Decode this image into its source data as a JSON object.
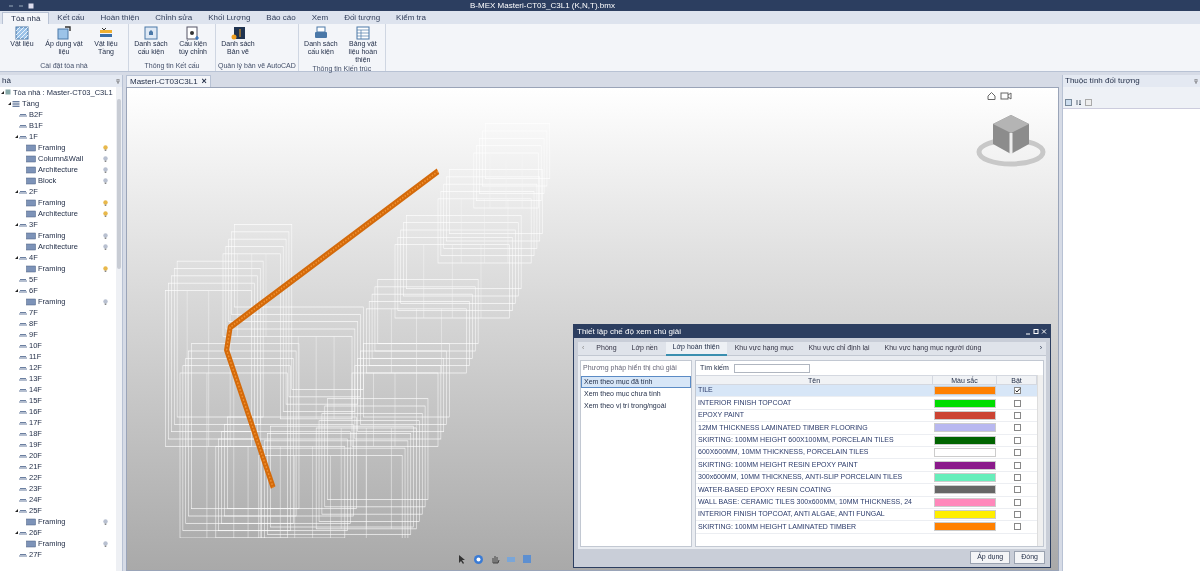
{
  "window": {
    "title": "B-MEX Masteri-CT03_C3L1 (K,N,T).bmx"
  },
  "ribbon": {
    "tabs": [
      {
        "label": "Tòa nhà",
        "selected": true
      },
      {
        "label": "Kết cấu",
        "selected": false
      },
      {
        "label": "Hoàn thiện",
        "selected": false
      },
      {
        "label": "Chỉnh sửa",
        "selected": false
      },
      {
        "label": "Khối Lượng",
        "selected": false
      },
      {
        "label": "Báo cáo",
        "selected": false
      },
      {
        "label": "Xem",
        "selected": false
      },
      {
        "label": "Đối tượng",
        "selected": false
      },
      {
        "label": "Kiểm tra",
        "selected": false
      }
    ],
    "groups": [
      {
        "label": "Cài đặt tòa nhà",
        "buttons": [
          {
            "label": "Vật liệu",
            "kind": "material"
          },
          {
            "label": "Áp dụng vật liệu",
            "kind": "apply"
          },
          {
            "label": "Vật liệu Tầng",
            "kind": "floor"
          }
        ]
      },
      {
        "label": "Thông tin Kết cấu",
        "buttons": [
          {
            "label": "Danh sách cấu kiện",
            "kind": "list"
          },
          {
            "label": "Cấu kiện tùy chỉnh",
            "kind": "custom"
          }
        ]
      },
      {
        "label": "Quản lý bản vẽ AutoCAD",
        "buttons": [
          {
            "label": "Danh sách Bản vẽ",
            "kind": "drawing"
          }
        ]
      },
      {
        "label": "Thông tin Kiến trúc",
        "buttons": [
          {
            "label": "Danh sách cấu kiện",
            "kind": "printer"
          },
          {
            "label": "Bảng vật liệu hoàn thiện",
            "kind": "table"
          }
        ]
      }
    ]
  },
  "left_panel": {
    "title": "hà",
    "tree": {
      "label": "Tòa nhà : Master-CT03_C3L1",
      "kind": "building",
      "children": [
        {
          "label": "Tầng",
          "kind": "group",
          "children": [
            {
              "label": "B2F",
              "kind": "floor"
            },
            {
              "label": "B1F",
              "kind": "floor"
            },
            {
              "label": "1F",
              "kind": "floor",
              "children": [
                {
                  "label": "Framing",
                  "kind": "layer",
                  "lit": true
                },
                {
                  "label": "Column&Wall",
                  "kind": "layer",
                  "lit": false
                },
                {
                  "label": "Architecture",
                  "kind": "layer",
                  "lit": false
                },
                {
                  "label": "Block",
                  "kind": "layer",
                  "lit": false
                }
              ]
            },
            {
              "label": "2F",
              "kind": "floor",
              "children": [
                {
                  "label": "Framing",
                  "kind": "layer",
                  "lit": true
                },
                {
                  "label": "Architecture",
                  "kind": "layer",
                  "lit": true
                }
              ]
            },
            {
              "label": "3F",
              "kind": "floor",
              "children": [
                {
                  "label": "Framing",
                  "kind": "layer",
                  "lit": false
                },
                {
                  "label": "Architecture",
                  "kind": "layer",
                  "lit": false
                }
              ]
            },
            {
              "label": "4F",
              "kind": "floor",
              "children": [
                {
                  "label": "Framing",
                  "kind": "layer",
                  "lit": true
                }
              ]
            },
            {
              "label": "5F",
              "kind": "floor"
            },
            {
              "label": "6F",
              "kind": "floor",
              "children": [
                {
                  "label": "Framing",
                  "kind": "layer",
                  "lit": false
                }
              ]
            },
            {
              "label": "7F",
              "kind": "floor"
            },
            {
              "label": "8F",
              "kind": "floor"
            },
            {
              "label": "9F",
              "kind": "floor"
            },
            {
              "label": "10F",
              "kind": "floor"
            },
            {
              "label": "11F",
              "kind": "floor"
            },
            {
              "label": "12F",
              "kind": "floor"
            },
            {
              "label": "13F",
              "kind": "floor"
            },
            {
              "label": "14F",
              "kind": "floor"
            },
            {
              "label": "15F",
              "kind": "floor"
            },
            {
              "label": "16F",
              "kind": "floor"
            },
            {
              "label": "17F",
              "kind": "floor"
            },
            {
              "label": "18F",
              "kind": "floor"
            },
            {
              "label": "19F",
              "kind": "floor"
            },
            {
              "label": "20F",
              "kind": "floor"
            },
            {
              "label": "21F",
              "kind": "floor"
            },
            {
              "label": "22F",
              "kind": "floor"
            },
            {
              "label": "23F",
              "kind": "floor"
            },
            {
              "label": "24F",
              "kind": "floor"
            },
            {
              "label": "25F",
              "kind": "floor",
              "children": [
                {
                  "label": "Framing",
                  "kind": "layer",
                  "lit": false
                }
              ]
            },
            {
              "label": "26F",
              "kind": "floor",
              "children": [
                {
                  "label": "Framing",
                  "kind": "layer",
                  "lit": false
                }
              ]
            },
            {
              "label": "27F",
              "kind": "floor"
            }
          ]
        }
      ]
    }
  },
  "document_tab": {
    "label": "Masteri-CT03C3L1",
    "close": "×"
  },
  "right_panel": {
    "title": "Thuộc tính đối tượng"
  },
  "dialog": {
    "title": "Thiết lập chế độ xem chú giải",
    "tab_prev": "‹",
    "tab_next": "›",
    "tabs": [
      {
        "label": "Phòng",
        "selected": false
      },
      {
        "label": "Lớp nền",
        "selected": false
      },
      {
        "label": "Lớp hoàn thiện",
        "selected": true
      },
      {
        "label": "Khu vực hạng mục",
        "selected": false
      },
      {
        "label": "Khu vực chỉ định lại",
        "selected": false
      },
      {
        "label": "Khu vực hạng mục người dùng",
        "selected": false
      }
    ],
    "methods_title": "Phương pháp hiển thị chú giải",
    "methods": [
      {
        "label": "Xem theo mục đã tính",
        "selected": true
      },
      {
        "label": "Xem theo mục chưa tính",
        "selected": false
      },
      {
        "label": "Xem theo vị trí trong/ngoài",
        "selected": false
      }
    ],
    "search": {
      "label": "Tìm kiếm"
    },
    "table": {
      "columns": [
        "Tên",
        "Màu sắc",
        "Bật"
      ],
      "rows": [
        {
          "name": "TILE",
          "color": "#ff8000",
          "checked": true,
          "selected": true
        },
        {
          "name": "INTERIOR FINISH TOPCOAT",
          "color": "#00dd00",
          "checked": false,
          "selected": false
        },
        {
          "name": "EPOXY PAINT",
          "color": "#cc4433",
          "checked": false,
          "selected": false
        },
        {
          "name": "12MM THICKNESS LAMINATED TIMBER FLOORING",
          "color": "#b8b8f0",
          "checked": false,
          "selected": false
        },
        {
          "name": "SKIRTING: 100MM HEIGHT 600X100MM, PORCELAIN TILES",
          "color": "#006400",
          "checked": false,
          "selected": false
        },
        {
          "name": "600X600MM, 10MM THICKNESS, PORCELAIN TILES",
          "color": "#ffffff",
          "checked": false,
          "selected": false
        },
        {
          "name": "SKIRTING: 100MM HEIGHT RESIN EPOXY PAINT",
          "color": "#8b1a8b",
          "checked": false,
          "selected": false
        },
        {
          "name": "300x600MM, 10MM THICKNESS, ANTI-SLIP PORCELAIN TILES",
          "color": "#66eebb",
          "checked": false,
          "selected": false
        },
        {
          "name": "WATER-BASED EPOXY RESIN COATING",
          "color": "#666666",
          "checked": false,
          "selected": false
        },
        {
          "name": "WALL BASE: CERAMIC TILES 300x600MM, 10MM THICKNESS, 24",
          "color": "#ff88bb",
          "checked": false,
          "selected": false
        },
        {
          "name": "INTERIOR FINISH TOPCOAT, ANTI ALGAE, ANTI FUNGAL",
          "color": "#ffee00",
          "checked": false,
          "selected": false
        },
        {
          "name": "SKIRTING: 100MM HEIGHT LAMINATED TIMBER",
          "color": "#ff8000",
          "checked": false,
          "selected": false
        }
      ]
    },
    "buttons": [
      "Áp dụng",
      "Đóng"
    ]
  }
}
